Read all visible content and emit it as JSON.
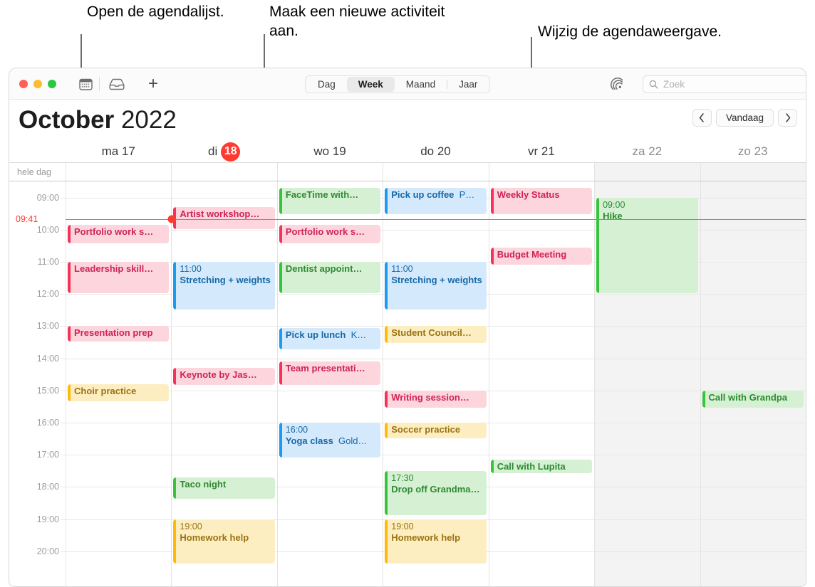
{
  "callouts": [
    {
      "id": "c1",
      "text": "Open de agendalijst."
    },
    {
      "id": "c2",
      "text": "Maak een nieuwe activiteit aan."
    },
    {
      "id": "c3",
      "text": "Wijzig de agendaweergave."
    }
  ],
  "toolbar": {
    "calendars_icon": "calendar-icon",
    "inbox_icon": "inbox-tray-icon",
    "new_event_label": "+",
    "radar_icon": "location-radar-icon",
    "search_icon": "search-icon",
    "search_placeholder": "Zoek",
    "views": [
      {
        "label": "Dag",
        "selected": false
      },
      {
        "label": "Week",
        "selected": true
      },
      {
        "label": "Maand",
        "selected": false
      },
      {
        "label": "Jaar",
        "selected": false
      }
    ]
  },
  "header": {
    "month": "October",
    "year": "2022",
    "prev_label": "‹",
    "today_label": "Vandaag",
    "next_label": "›"
  },
  "days": [
    {
      "weekday": "ma",
      "date": "17",
      "today": false,
      "weekend": false
    },
    {
      "weekday": "di",
      "date": "18",
      "today": true,
      "weekend": false
    },
    {
      "weekday": "wo",
      "date": "19",
      "today": false,
      "weekend": false
    },
    {
      "weekday": "do",
      "date": "20",
      "today": false,
      "weekend": false
    },
    {
      "weekday": "vr",
      "date": "21",
      "today": false,
      "weekend": false
    },
    {
      "weekday": "za",
      "date": "22",
      "today": false,
      "weekend": true
    },
    {
      "weekday": "zo",
      "date": "23",
      "today": false,
      "weekend": true
    }
  ],
  "allday_label": "hele dag",
  "time_labels": [
    "09:00",
    "10:00",
    "11:00",
    "12:00",
    "13:00",
    "14:00",
    "15:00",
    "16:00",
    "17:00",
    "18:00",
    "19:00",
    "20:00"
  ],
  "now": {
    "label": "09:41",
    "day_index": 1
  },
  "colors": {
    "red_accent": "#f6315c",
    "red_fill": "#fcd5dd",
    "blue_accent": "#1a9bf0",
    "blue_fill": "#d4e9fb",
    "green_accent": "#37c43a",
    "green_fill": "#d5f0d2",
    "yellow_accent": "#ffb90a",
    "yellow_fill": "#fdeec2",
    "today_badge": "#ff3b30",
    "now_line": "#fc3c2d"
  },
  "events": [
    {
      "day": 0,
      "start": 9.85,
      "end": 10.45,
      "color": "red",
      "time": "",
      "title": "Portfolio work s…",
      "loc": "",
      "lines": 1
    },
    {
      "day": 0,
      "start": 11.0,
      "end": 12.0,
      "color": "red",
      "time": "",
      "title": "Leadership skill…",
      "loc": "",
      "lines": 1
    },
    {
      "day": 0,
      "start": 13.0,
      "end": 13.5,
      "color": "red",
      "time": "",
      "title": "Presentation prep",
      "loc": "",
      "lines": 1
    },
    {
      "day": 0,
      "start": 14.8,
      "end": 15.35,
      "color": "yellow",
      "time": "",
      "title": "Choir practice",
      "loc": "",
      "lines": 1
    },
    {
      "day": 1,
      "start": 9.3,
      "end": 10.0,
      "color": "red",
      "time": "",
      "title": "Artist workshop…",
      "loc": "",
      "lines": 1
    },
    {
      "day": 1,
      "start": 11.0,
      "end": 12.5,
      "color": "blue",
      "time": "11:00",
      "title": "Stretching + weights",
      "loc": "",
      "lines": 2
    },
    {
      "day": 1,
      "start": 14.3,
      "end": 14.85,
      "color": "red",
      "time": "",
      "title": "Keynote by Jas…",
      "loc": "",
      "lines": 1
    },
    {
      "day": 1,
      "start": 17.7,
      "end": 18.4,
      "color": "green",
      "time": "",
      "title": "Taco night",
      "loc": "",
      "lines": 1
    },
    {
      "day": 1,
      "start": 19.0,
      "end": 20.4,
      "color": "yellow",
      "time": "19:00",
      "title": "Homework help",
      "loc": "",
      "lines": 1
    },
    {
      "day": 2,
      "start": 8.7,
      "end": 9.55,
      "color": "green",
      "time": "",
      "title": "FaceTime with…",
      "loc": "",
      "lines": 1
    },
    {
      "day": 2,
      "start": 9.85,
      "end": 10.45,
      "color": "red",
      "time": "",
      "title": "Portfolio work s…",
      "loc": "",
      "lines": 1
    },
    {
      "day": 2,
      "start": 11.0,
      "end": 12.0,
      "color": "green",
      "time": "",
      "title": "Dentist appoint…",
      "loc": "",
      "lines": 1
    },
    {
      "day": 2,
      "start": 13.05,
      "end": 13.75,
      "color": "blue",
      "time": "",
      "title": "Pick up lunch",
      "loc": "K…",
      "lines": 1
    },
    {
      "day": 2,
      "start": 14.1,
      "end": 14.85,
      "color": "red",
      "time": "",
      "title": "Team presentati…",
      "loc": "",
      "lines": 1
    },
    {
      "day": 2,
      "start": 16.0,
      "end": 17.1,
      "color": "blue",
      "time": "16:00",
      "title": "Yoga class",
      "loc": "Gold…",
      "lines": 1
    },
    {
      "day": 3,
      "start": 8.7,
      "end": 9.55,
      "color": "blue",
      "time": "",
      "title": "Pick up coffee",
      "loc": "P…",
      "lines": 1
    },
    {
      "day": 3,
      "start": 11.0,
      "end": 12.5,
      "color": "blue",
      "time": "11:00",
      "title": "Stretching + weights",
      "loc": "",
      "lines": 2
    },
    {
      "day": 3,
      "start": 13.0,
      "end": 13.55,
      "color": "yellow",
      "time": "",
      "title": "Student Council…",
      "loc": "",
      "lines": 1
    },
    {
      "day": 3,
      "start": 15.0,
      "end": 15.55,
      "color": "red",
      "time": "",
      "title": "Writing session…",
      "loc": "",
      "lines": 1
    },
    {
      "day": 3,
      "start": 16.0,
      "end": 16.5,
      "color": "yellow",
      "time": "",
      "title": "Soccer practice",
      "loc": "",
      "lines": 1
    },
    {
      "day": 3,
      "start": 17.5,
      "end": 18.9,
      "color": "green",
      "time": "17:30",
      "title": "Drop off Grandma…",
      "loc": "",
      "lines": 2
    },
    {
      "day": 3,
      "start": 19.0,
      "end": 20.4,
      "color": "yellow",
      "time": "19:00",
      "title": "Homework help",
      "loc": "",
      "lines": 1
    },
    {
      "day": 4,
      "start": 8.7,
      "end": 9.55,
      "color": "red",
      "time": "",
      "title": "Weekly Status",
      "loc": "",
      "lines": 1
    },
    {
      "day": 4,
      "start": 10.55,
      "end": 11.1,
      "color": "red",
      "time": "",
      "title": "Budget Meeting",
      "loc": "",
      "lines": 1
    },
    {
      "day": 4,
      "start": 17.15,
      "end": 17.6,
      "color": "green",
      "time": "",
      "title": "Call with Lupita",
      "loc": "",
      "lines": 1
    },
    {
      "day": 5,
      "start": 9.0,
      "end": 12.0,
      "color": "green",
      "time": "09:00",
      "title": "Hike",
      "loc": "",
      "lines": 1
    },
    {
      "day": 6,
      "start": 15.0,
      "end": 15.55,
      "color": "green",
      "time": "",
      "title": "Call with Grandpa",
      "loc": "",
      "lines": 1
    }
  ]
}
